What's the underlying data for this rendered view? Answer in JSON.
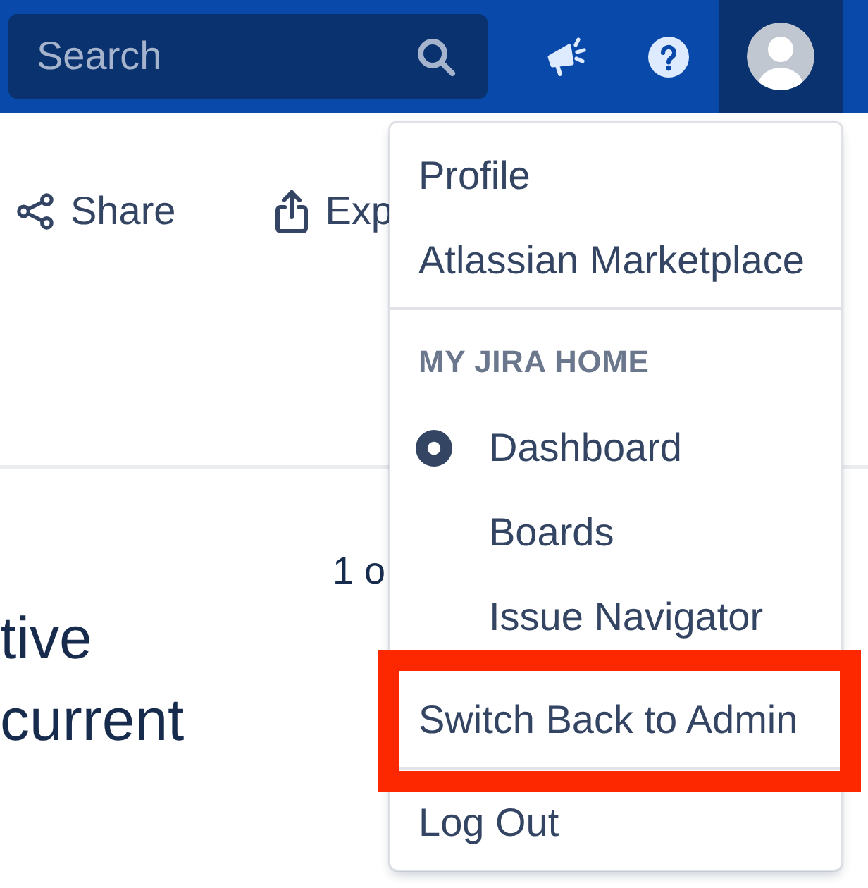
{
  "top_bar": {
    "search": {
      "placeholder": "Search"
    }
  },
  "toolbar": [
    {
      "kind": "share",
      "label": "Share"
    },
    {
      "kind": "export",
      "label": "Exp"
    }
  ],
  "content": {
    "pagination": "1 o",
    "heading_lines": [
      "tive",
      "current"
    ]
  },
  "account_menu": {
    "sections": [
      {
        "kind": "links",
        "items": [
          {
            "label": "Profile",
            "highlighted": false
          },
          {
            "label": "Atlassian Marketplace",
            "highlighted": false
          }
        ]
      },
      {
        "kind": "radio",
        "heading": "MY JIRA HOME",
        "items": [
          {
            "label": "Dashboard",
            "selected": true,
            "highlighted": false
          },
          {
            "label": "Boards",
            "selected": false,
            "highlighted": false
          },
          {
            "label": "Issue Navigator",
            "selected": false,
            "highlighted": false
          }
        ]
      },
      {
        "kind": "links",
        "items": [
          {
            "label": "Switch Back to Admin",
            "highlighted": true
          }
        ]
      },
      {
        "kind": "links",
        "items": [
          {
            "label": "Log Out",
            "highlighted": false
          }
        ]
      }
    ]
  }
}
